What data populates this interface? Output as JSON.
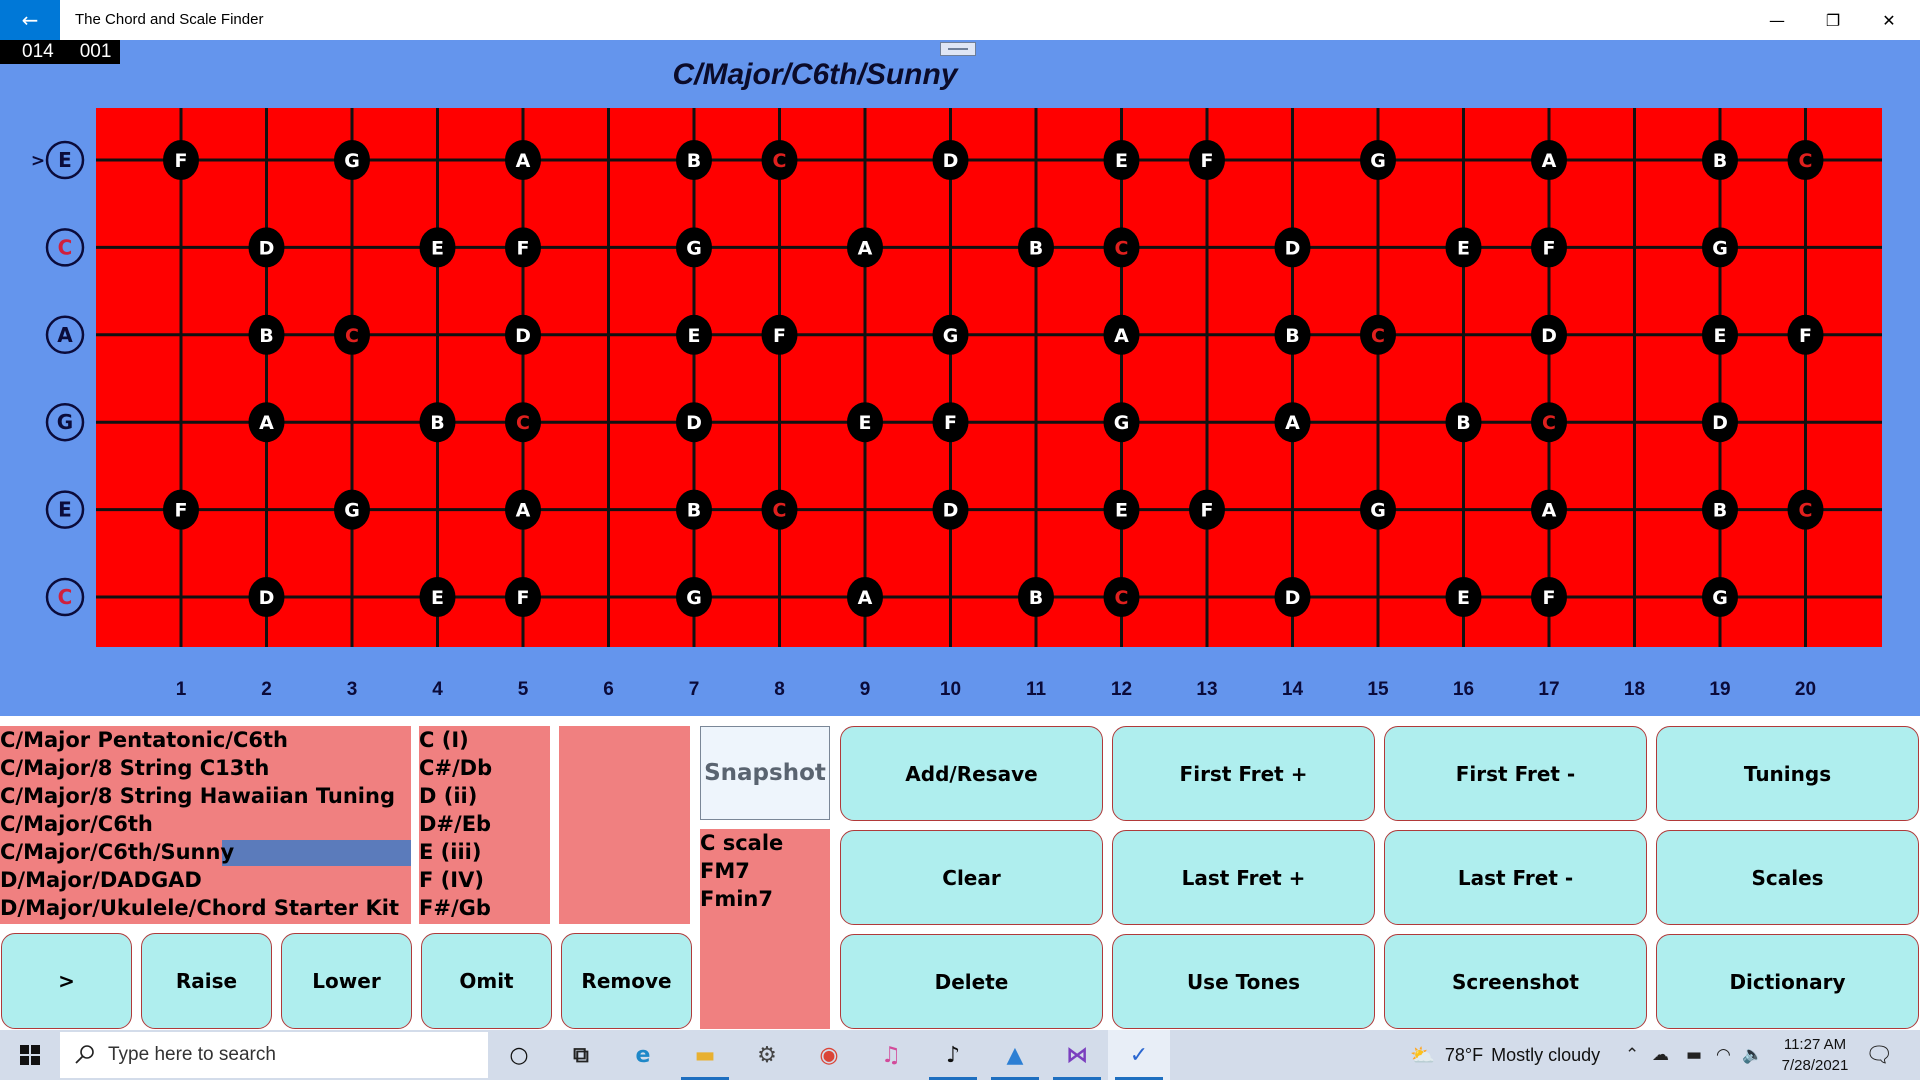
{
  "window": {
    "title": "The Chord and Scale Finder",
    "back_icon": "←",
    "minimize_icon": "—",
    "restore_icon": "❐",
    "close_icon": "✕"
  },
  "counter": {
    "left": "014",
    "right": "001"
  },
  "fretboard": {
    "title": "C/Major/C6th/Sunny",
    "root_note": "C",
    "colors": {
      "board": "#ff0000",
      "background": "#6495ed",
      "dot": "#000000",
      "note_text": "#ffffff",
      "root_text": "#e0201e",
      "string_label_ring": "#0b0b3a",
      "root_label": "#d01f3c"
    },
    "selected_string_marker": ">",
    "fret_numbers": [
      "1",
      "2",
      "3",
      "4",
      "5",
      "6",
      "7",
      "8",
      "9",
      "10",
      "11",
      "12",
      "13",
      "14",
      "15",
      "16",
      "17",
      "18",
      "19",
      "20"
    ],
    "strings": [
      {
        "open": "E",
        "selected": true,
        "notes": [
          [
            "1",
            "F"
          ],
          [
            "3",
            "G"
          ],
          [
            "5",
            "A"
          ],
          [
            "7",
            "B"
          ],
          [
            "8",
            "C"
          ],
          [
            "10",
            "D"
          ],
          [
            "12",
            "E"
          ],
          [
            "13",
            "F"
          ],
          [
            "15",
            "G"
          ],
          [
            "17",
            "A"
          ],
          [
            "19",
            "B"
          ],
          [
            "20",
            "C"
          ]
        ]
      },
      {
        "open": "C",
        "selected": false,
        "notes": [
          [
            "2",
            "D"
          ],
          [
            "4",
            "E"
          ],
          [
            "5",
            "F"
          ],
          [
            "7",
            "G"
          ],
          [
            "9",
            "A"
          ],
          [
            "11",
            "B"
          ],
          [
            "12",
            "C"
          ],
          [
            "14",
            "D"
          ],
          [
            "16",
            "E"
          ],
          [
            "17",
            "F"
          ],
          [
            "19",
            "G"
          ]
        ]
      },
      {
        "open": "A",
        "selected": false,
        "notes": [
          [
            "2",
            "B"
          ],
          [
            "3",
            "C"
          ],
          [
            "5",
            "D"
          ],
          [
            "7",
            "E"
          ],
          [
            "8",
            "F"
          ],
          [
            "10",
            "G"
          ],
          [
            "12",
            "A"
          ],
          [
            "14",
            "B"
          ],
          [
            "15",
            "C"
          ],
          [
            "17",
            "D"
          ],
          [
            "19",
            "E"
          ],
          [
            "20",
            "F"
          ]
        ]
      },
      {
        "open": "G",
        "selected": false,
        "notes": [
          [
            "2",
            "A"
          ],
          [
            "4",
            "B"
          ],
          [
            "5",
            "C"
          ],
          [
            "7",
            "D"
          ],
          [
            "9",
            "E"
          ],
          [
            "10",
            "F"
          ],
          [
            "12",
            "G"
          ],
          [
            "14",
            "A"
          ],
          [
            "16",
            "B"
          ],
          [
            "17",
            "C"
          ],
          [
            "19",
            "D"
          ]
        ]
      },
      {
        "open": "E",
        "selected": false,
        "notes": [
          [
            "1",
            "F"
          ],
          [
            "3",
            "G"
          ],
          [
            "5",
            "A"
          ],
          [
            "7",
            "B"
          ],
          [
            "8",
            "C"
          ],
          [
            "10",
            "D"
          ],
          [
            "12",
            "E"
          ],
          [
            "13",
            "F"
          ],
          [
            "15",
            "G"
          ],
          [
            "17",
            "A"
          ],
          [
            "19",
            "B"
          ],
          [
            "20",
            "C"
          ]
        ]
      },
      {
        "open": "C",
        "selected": false,
        "notes": [
          [
            "2",
            "D"
          ],
          [
            "4",
            "E"
          ],
          [
            "5",
            "F"
          ],
          [
            "7",
            "G"
          ],
          [
            "9",
            "A"
          ],
          [
            "11",
            "B"
          ],
          [
            "12",
            "C"
          ],
          [
            "14",
            "D"
          ],
          [
            "16",
            "E"
          ],
          [
            "17",
            "F"
          ],
          [
            "19",
            "G"
          ]
        ]
      }
    ]
  },
  "tunings_list": {
    "items": [
      "C/Major Pentatonic/C6th",
      "C/Major/8 String C13th",
      "C/Major/8 String Hawaiian Tuning",
      "C/Major/C6th",
      "C/Major/C6th/Sunny",
      "D/Major/DADGAD",
      "D/Major/Ukulele/Chord Starter Kit"
    ],
    "selected_index": 4
  },
  "keys_list": {
    "items": [
      "C (I)",
      "C#/Db",
      "D (ii)",
      "D#/Eb",
      "E (iii)",
      "F (IV)",
      "F#/Gb"
    ]
  },
  "chords_list": {
    "items": []
  },
  "snapshot": {
    "label": "Snapshot"
  },
  "snapshot_list": {
    "items": [
      "C scale",
      "FM7",
      "Fmin7"
    ]
  },
  "left_buttons": [
    ">",
    "Raise",
    "Lower",
    "Omit",
    "Remove"
  ],
  "grid_buttons": [
    [
      "Add/Resave",
      "First Fret +",
      "First Fret -",
      "Tunings"
    ],
    [
      "Clear",
      "Last Fret +",
      "Last Fret -",
      "Scales"
    ],
    [
      "Delete",
      "Use Tones",
      "Screenshot",
      "Dictionary"
    ]
  ],
  "taskbar": {
    "start_icon": "windows-logo",
    "search_placeholder": "Type here to search",
    "apps": [
      {
        "name": "cortana",
        "glyph": "○",
        "active": false
      },
      {
        "name": "task-view",
        "glyph": "⧉",
        "active": false
      },
      {
        "name": "edge",
        "glyph": "e",
        "active": false
      },
      {
        "name": "file-explorer",
        "glyph": "▬",
        "active": true
      },
      {
        "name": "settings",
        "glyph": "⚙",
        "active": false
      },
      {
        "name": "chrome",
        "glyph": "◉",
        "active": false
      },
      {
        "name": "itunes",
        "glyph": "♫",
        "active": false
      },
      {
        "name": "music-app",
        "glyph": "♪",
        "active": true
      },
      {
        "name": "photos",
        "glyph": "▲",
        "active": true
      },
      {
        "name": "visual-studio",
        "glyph": "⋈",
        "active": true
      },
      {
        "name": "chord-finder",
        "glyph": "✓",
        "active": true
      }
    ],
    "weather": {
      "temp": "78°F",
      "condition": "Mostly cloudy"
    },
    "clock": {
      "time": "11:27 AM",
      "date": "7/28/2021"
    }
  }
}
